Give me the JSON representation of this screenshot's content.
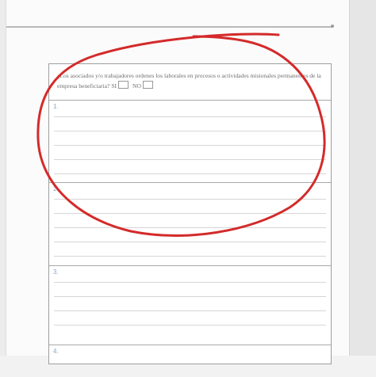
{
  "document": {
    "question_text": "¿Los asociados y/o trabajadores ordenes los laborales en procesos o actividades misionales permanentes de la empresa beneficiaria?",
    "yes_label": "SI",
    "no_label": "NO"
  },
  "answer_blocks": [
    {
      "marker": "1."
    },
    {
      "marker": "2."
    },
    {
      "marker": "3."
    },
    {
      "marker": "4."
    }
  ],
  "annotation": {
    "color": "#d42a2a",
    "shape": "hand-drawn ellipse"
  }
}
